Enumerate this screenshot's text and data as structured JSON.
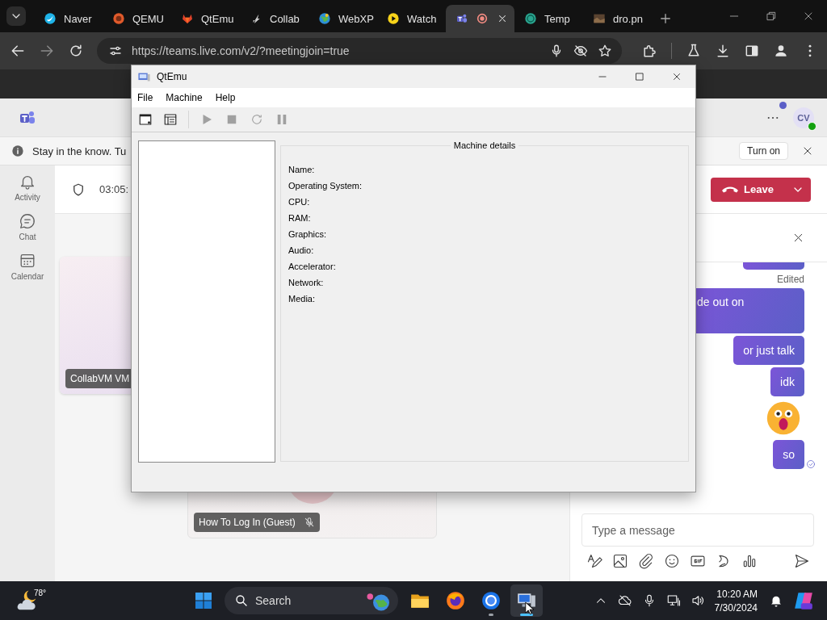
{
  "browser": {
    "tabs": [
      {
        "title": "Naver",
        "kind": "bird",
        "selected": false,
        "recording": false
      },
      {
        "title": "QEMU",
        "kind": "orb",
        "selected": false,
        "recording": false
      },
      {
        "title": "QtEmu",
        "kind": "fox",
        "selected": false,
        "recording": false
      },
      {
        "title": "Collab",
        "kind": "leaf",
        "selected": false,
        "recording": false
      },
      {
        "title": "WebXP",
        "kind": "globe",
        "selected": false,
        "recording": false
      },
      {
        "title": "Watch",
        "kind": "play",
        "selected": false,
        "recording": false
      },
      {
        "kind": "team",
        "selected": true,
        "recording": true
      },
      {
        "title": "Temp",
        "kind": "circle",
        "selected": false,
        "recording": false
      },
      {
        "title": "dro.pn",
        "kind": "image",
        "selected": false,
        "recording": false
      }
    ],
    "url": "https://teams.live.com/v2/?meetingjoin=true"
  },
  "teams": {
    "avatar": "CV",
    "banner": {
      "text": "Stay in the know. Tu",
      "button": "Turn on"
    },
    "rail": [
      {
        "label": "Activity",
        "kind": "bell"
      },
      {
        "label": "Chat",
        "kind": "chat"
      },
      {
        "label": "Calendar",
        "kind": "calendar"
      }
    ],
    "meeting": {
      "timer": "03:05:",
      "leave": "Leave"
    },
    "tiles": [
      {
        "name": "CollabVM VM",
        "muted": false,
        "avatar": false
      },
      {
        "name": "How To Log In (Guest)",
        "muted": true,
        "avatar": true
      }
    ],
    "chat": {
      "messages": [
        {
          "kind": "stub"
        },
        {
          "kind": "note",
          "text": "Edited"
        },
        {
          "kind": "clipped",
          "text": "de out on",
          "seen": false
        },
        {
          "kind": "text",
          "text": "or just talk",
          "seen": false
        },
        {
          "kind": "text",
          "text": "idk",
          "seen": false
        },
        {
          "kind": "emoji"
        },
        {
          "kind": "text",
          "text": "so",
          "seen": true
        }
      ],
      "placeholder": "Type a message"
    }
  },
  "qtemu": {
    "title": "QtEmu",
    "menu": [
      "File",
      "Machine",
      "Help"
    ],
    "tools": [
      {
        "kind": "new",
        "disabled": false
      },
      {
        "kind": "list",
        "disabled": false
      },
      {
        "kind": "play",
        "disabled": true
      },
      {
        "kind": "stop",
        "disabled": true
      },
      {
        "kind": "reset",
        "disabled": true
      },
      {
        "kind": "pause",
        "disabled": true
      }
    ],
    "details": {
      "title": "Machine details",
      "fields": [
        "Name:",
        "Operating System:",
        "CPU:",
        "RAM:",
        "Graphics:",
        "Audio:",
        "Accelerator:",
        "Network:",
        "Media:"
      ]
    }
  },
  "taskbar": {
    "temperature": "78°",
    "search": "Search",
    "apps": [
      {
        "kind": "folder",
        "running": false,
        "selected": false
      },
      {
        "kind": "fox",
        "running": false,
        "selected": false
      },
      {
        "kind": "ring",
        "running": true,
        "selected": false
      },
      {
        "kind": "monitor",
        "running": true,
        "selected": true
      }
    ],
    "time": "10:20 AM",
    "date": "7/30/2024"
  }
}
